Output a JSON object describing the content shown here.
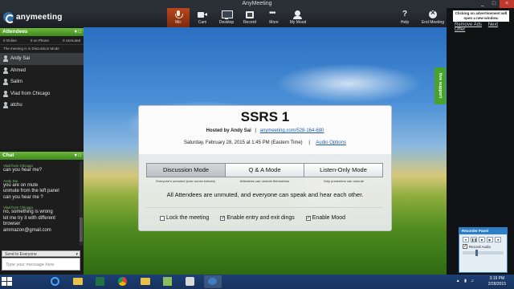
{
  "window": {
    "title": "AnyMeeting",
    "controls": [
      "_",
      "□",
      "×"
    ]
  },
  "logo": {
    "text": "anymeeting"
  },
  "toolbar": {
    "buttons": [
      {
        "label": "Mic",
        "icon": "microphone-icon"
      },
      {
        "label": "Cam",
        "icon": "camera-icon"
      },
      {
        "label": "Desktop",
        "icon": "desktop-icon"
      },
      {
        "label": "Record",
        "icon": "record-icon"
      },
      {
        "label": "More",
        "icon": "more-icon"
      },
      {
        "label": "My Mood",
        "icon": "mood-icon"
      }
    ],
    "help_label": "Help",
    "end_label": "End Meeting"
  },
  "ad": {
    "notice": "Clicking on advertisement will open a new window.",
    "remove_ads": "Remove Ads",
    "next_offer": "Next Offer"
  },
  "attendees": {
    "header": "Attendees",
    "controls": "▾ □",
    "counts": [
      "0 Online",
      "0 on Phone",
      "0 Unmuted"
    ],
    "mode_text": "The meeting is in Discussion Mode",
    "people": [
      "Andy Sai",
      "Ahmed",
      "Salim",
      "Vlad from Chicago",
      "atchu"
    ]
  },
  "chat": {
    "header": "Chat",
    "controls": "▾ □",
    "messages": [
      {
        "sender": "Vlad from Chicago",
        "lines": [
          "can you hear me?"
        ]
      },
      {
        "sender": "Andy Sai",
        "lines": [
          "you are on mute",
          "unmute from the left panel",
          "can you hear me ?"
        ]
      },
      {
        "sender": "Vlad from Chicago",
        "lines": [
          "no, something is wrong",
          "let me try it with different",
          "browser",
          "ammazon@gmail.com"
        ]
      }
    ],
    "send_to": "Send to Everyone",
    "input_placeholder": "Type your message here"
  },
  "live_support": "live support",
  "session": {
    "title": "SSRS 1",
    "hosted_prefix": "Hosted by Andy Sai",
    "separator": "|",
    "link": "anymeeting.com/528-164-680",
    "date": "Saturday, February 28, 2015 at 1:45 PM (Eastern Time)",
    "audio_options": "Audio Options",
    "modes": [
      {
        "label": "Discussion Mode",
        "desc": "Everyone's unmuted (max nunes echoes)",
        "selected": true
      },
      {
        "label": "Q & A Mode",
        "desc": "Attendees can unmute themselves",
        "selected": false
      },
      {
        "label": "Listen-Only Mode",
        "desc": "Only presenters can unmute",
        "selected": false
      }
    ],
    "message": "All Attendees are unmuted, and everyone can speak and hear each other.",
    "options": [
      {
        "label": "Lock the meeting",
        "checked": false
      },
      {
        "label": "Enable entry and exit dings",
        "checked": true
      },
      {
        "label": "Enable Mood",
        "checked": true
      }
    ]
  },
  "recorder": {
    "title": "Recorder Panel",
    "buttons": [
      "●",
      "❚❚",
      "■",
      "▶",
      "◄",
      "►"
    ],
    "record_audio": "Record Audio"
  },
  "taskbar": {
    "time": "3:19 PM",
    "date": "2/28/2015",
    "icons": [
      "start-icon",
      "ie-icon",
      "folder-icon",
      "excel-icon",
      "chrome-icon",
      "folder-icon",
      "photos-icon",
      "paint-icon",
      "anymeeting-icon"
    ]
  },
  "colors": {
    "toolbar_bg": "#1c2026",
    "panel_header": "#4a9a27",
    "mic_active": "#a53c16",
    "link": "#1d5ea8",
    "taskbar": "#1d3f73"
  }
}
